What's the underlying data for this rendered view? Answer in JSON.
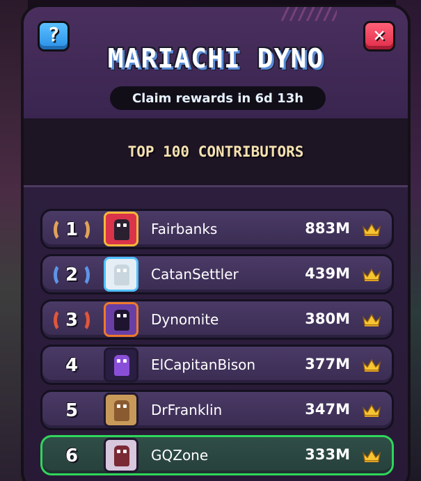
{
  "header": {
    "help_glyph": "?",
    "close_glyph": "✕",
    "title": "MARIACHI DYNO",
    "timer": "Claim rewards in 6d 13h"
  },
  "section": {
    "title": "TOP 100 CONTRIBUTORS"
  },
  "colors": {
    "gold": "#f3b93a",
    "silver": "#4fc0ff",
    "bronze": "#ef7a2a",
    "highlight": "#2fd65a",
    "help_button": "#2a8fe6",
    "close_button": "#e02b48"
  },
  "leaderboard": [
    {
      "rank": "1",
      "name": "Fairbanks",
      "score": "883M",
      "medal": "gold",
      "avatar_icon": "red-dino-avatar-icon"
    },
    {
      "rank": "2",
      "name": "CatanSettler",
      "score": "439M",
      "medal": "silver",
      "avatar_icon": "white-dino-avatar-icon"
    },
    {
      "rank": "3",
      "name": "Dynomite",
      "score": "380M",
      "medal": "bronze",
      "avatar_icon": "purple-dino-avatar-icon"
    },
    {
      "rank": "4",
      "name": "ElCapitanBison",
      "score": "377M",
      "medal": "none",
      "avatar_icon": "wizard-avatar-icon"
    },
    {
      "rank": "5",
      "name": "DrFranklin",
      "score": "347M",
      "medal": "none",
      "avatar_icon": "tan-dino-avatar-icon"
    },
    {
      "rank": "6",
      "name": "GQZone",
      "score": "333M",
      "medal": "none",
      "avatar_icon": "chef-dino-avatar-icon",
      "is_current_user": true
    }
  ]
}
